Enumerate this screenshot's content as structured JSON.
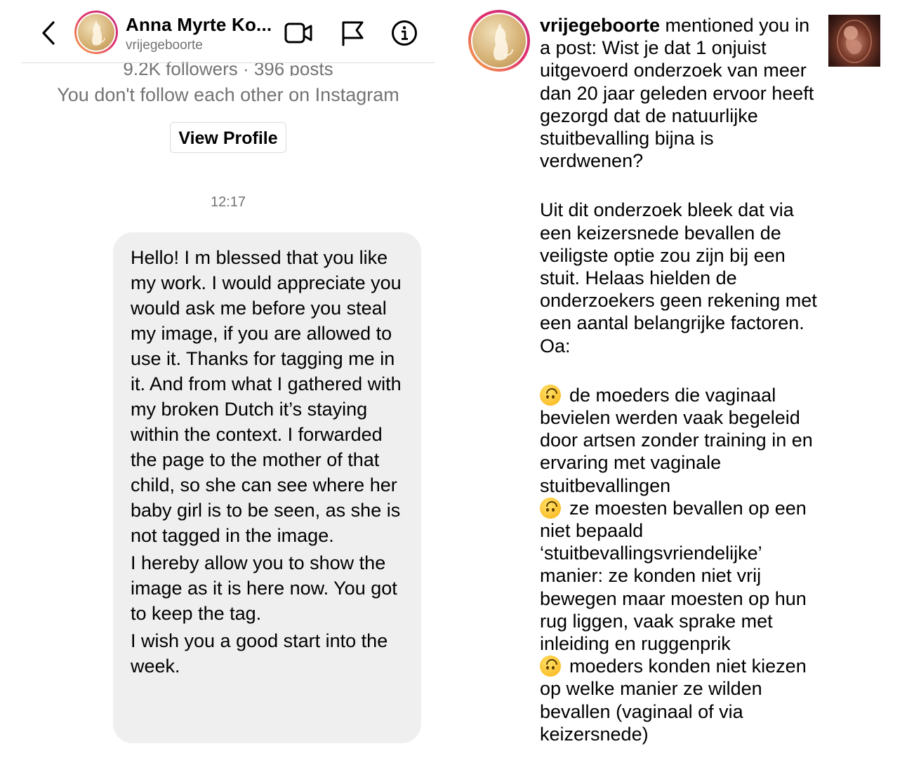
{
  "left": {
    "header": {
      "name": "Anna Myrte Ko...",
      "username": "vrijegeboorte"
    },
    "icons": [
      "back-icon",
      "video-call-icon",
      "flag-icon",
      "info-icon"
    ],
    "profile_card": {
      "followers_line": "9.2K followers · 396 posts",
      "relation": "You don't follow each other on Instagram",
      "view_profile_label": "View Profile"
    },
    "timestamp": "12:17",
    "message": {
      "paragraphs": [
        "Hello! I m blessed that you like my work. I would appreciate you would ask me before you steal my image, if you are allowed to use it. Thanks for tagging me in it. And from what I gathered with my broken Dutch it’s staying within the context. I forwarded the page to the mother of that child, so she can see where her baby girl is to be seen, as she is not tagged in the image.",
        "I hereby allow you to show the image as it is here now. You got to keep the tag.",
        "I wish you a good start into the week."
      ]
    }
  },
  "right": {
    "notification": {
      "username": "vrijegeboorte",
      "action": " mentioned you in a post: Wist je dat 1 onjuist uitgevoerd onderzoek van meer dan 20  jaar geleden ervoor heeft gezorgd dat de natuurlijke stuitbevalling bijna is verdwenen?",
      "paragraph2": "Uit dit onderzoek bleek dat via een keizersnede bevallen de veiligste optie zou zijn bij een stuit. Helaas hielden de onderzoekers geen rekening met een aantal belangrijke factoren. Oa:",
      "bullets": [
        "de moeders die vaginaal bevielen werden vaak begeleid door artsen zonder training in en ervaring met vaginale stuitbevallingen",
        "ze moesten bevallen op een niet bepaald ‘stuitbevallingsvriendelijke’ manier: ze konden niet vrij bewegen maar moesten op hun rug liggen, vaak sprake met inleiding en ruggenprik",
        "moeders konden niet kiezen op welke manier ze wilden bevallen (vaginaal of via keizersnede)"
      ],
      "bullet_emoji": "upside-down-face-emoji"
    }
  }
}
